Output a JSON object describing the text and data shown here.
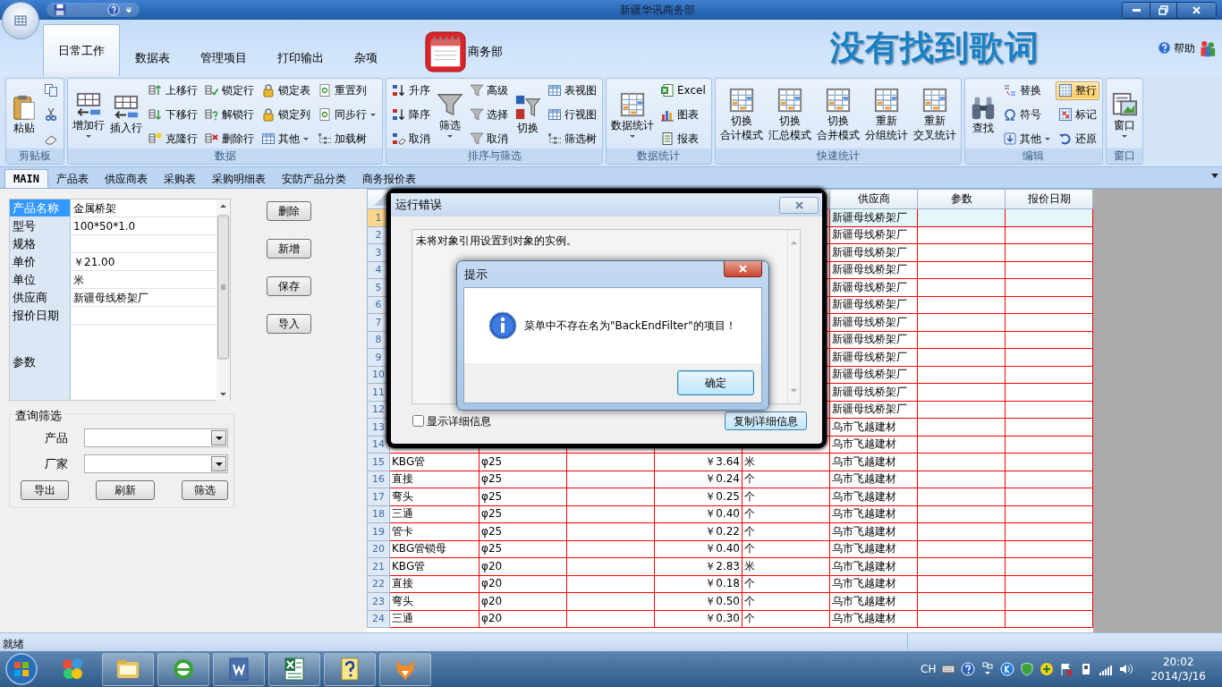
{
  "window": {
    "title": "新疆华讯商务部"
  },
  "ribbon": {
    "tabs": [
      {
        "label": "日常工作",
        "selected": true
      },
      {
        "label": "数据表",
        "selected": false
      },
      {
        "label": "管理项目",
        "selected": false
      },
      {
        "label": "打印输出",
        "selected": false
      },
      {
        "label": "杂项",
        "selected": false
      }
    ],
    "app_label": "商务部",
    "banner": "没有找到歌词",
    "help": "帮助",
    "groups": [
      {
        "label": "剪贴板",
        "columns": [
          [
            {
              "kind": "large",
              "label": "粘贴"
            }
          ],
          [
            {
              "kind": "icon"
            },
            {
              "kind": "icon"
            },
            {
              "kind": "icon"
            }
          ]
        ]
      },
      {
        "label": "数据",
        "columns": [
          [
            {
              "kind": "large-menu",
              "label": "增加行"
            }
          ],
          [
            {
              "kind": "large",
              "label": "插入行"
            }
          ],
          [
            {
              "kind": "small",
              "label": "上移行"
            },
            {
              "kind": "small",
              "label": "下移行"
            },
            {
              "kind": "small",
              "label": "克隆行"
            }
          ],
          [
            {
              "kind": "small",
              "label": "锁定行"
            },
            {
              "kind": "small",
              "label": "解锁行"
            },
            {
              "kind": "small",
              "label": "删除行"
            }
          ],
          [
            {
              "kind": "small",
              "label": "锁定表"
            },
            {
              "kind": "small",
              "label": "锁定列"
            },
            {
              "kind": "small-menu",
              "label": "其他"
            }
          ],
          [
            {
              "kind": "small",
              "label": "重置列"
            },
            {
              "kind": "small-menu",
              "label": "同步行"
            },
            {
              "kind": "small",
              "label": "加载树"
            }
          ]
        ]
      },
      {
        "label": "排序与筛选",
        "columns": [
          [
            {
              "kind": "small",
              "label": "升序"
            },
            {
              "kind": "small",
              "label": "降序"
            },
            {
              "kind": "small",
              "label": "取消"
            }
          ],
          [
            {
              "kind": "large-menu",
              "label": "筛选"
            }
          ],
          [
            {
              "kind": "small",
              "label": "高级"
            },
            {
              "kind": "small",
              "label": "选择"
            },
            {
              "kind": "small",
              "label": "取消"
            }
          ],
          [
            {
              "kind": "large",
              "label": "切换"
            }
          ],
          [
            {
              "kind": "small",
              "label": "表视图"
            },
            {
              "kind": "small",
              "label": "行视图"
            },
            {
              "kind": "small",
              "label": "筛选树"
            }
          ]
        ]
      },
      {
        "label": "数据统计",
        "columns": [
          [
            {
              "kind": "large-menu",
              "label": "数据统计"
            }
          ],
          [
            {
              "kind": "small",
              "label": "Excel"
            },
            {
              "kind": "small",
              "label": "图表"
            },
            {
              "kind": "small",
              "label": "报表"
            }
          ]
        ]
      },
      {
        "label": "快速统计",
        "columns": [
          [
            {
              "kind": "large",
              "label_lines": [
                "切换",
                "合计模式"
              ]
            }
          ],
          [
            {
              "kind": "large",
              "label_lines": [
                "切换",
                "汇总模式"
              ]
            }
          ],
          [
            {
              "kind": "large",
              "label_lines": [
                "切换",
                "合并模式"
              ]
            }
          ],
          [
            {
              "kind": "large",
              "label_lines": [
                "重新",
                "分组统计"
              ]
            }
          ],
          [
            {
              "kind": "large",
              "label_lines": [
                "重新",
                "交叉统计"
              ]
            }
          ]
        ]
      },
      {
        "label": "编辑",
        "columns": [
          [
            {
              "kind": "large",
              "label": "查找",
              "on": false
            }
          ],
          [
            {
              "kind": "small",
              "label": "替换",
              "on": false
            },
            {
              "kind": "small",
              "label": "符号",
              "on": false
            },
            {
              "kind": "small-menu",
              "label": "其他",
              "on": false
            }
          ],
          [
            {
              "kind": "small",
              "label": "整行",
              "on": true
            },
            {
              "kind": "small",
              "label": "标记",
              "on": false
            },
            {
              "kind": "small",
              "label": "还原",
              "on": false
            }
          ]
        ]
      },
      {
        "label": "窗口",
        "columns": [
          [
            {
              "kind": "large-menu",
              "label": "窗口"
            }
          ]
        ]
      }
    ]
  },
  "sheet_tabs": [
    {
      "label": "MAIN",
      "selected": true
    },
    {
      "label": "产品表",
      "selected": false
    },
    {
      "label": "供应商表",
      "selected": false
    },
    {
      "label": "采购表",
      "selected": false
    },
    {
      "label": "采购明细表",
      "selected": false
    },
    {
      "label": "安防产品分类",
      "selected": false
    },
    {
      "label": "商务报价表",
      "selected": false
    }
  ],
  "record": {
    "fields": [
      {
        "label": "产品名称",
        "value": "金属桥架",
        "selected": true
      },
      {
        "label": "型号",
        "value": "100*50*1.0",
        "selected": false
      },
      {
        "label": "规格",
        "selected": false
      },
      {
        "label": "单价",
        "value": "￥21.00",
        "selected": false
      },
      {
        "label": "单位",
        "value": "米",
        "selected": false
      },
      {
        "label": "供应商",
        "value": "新疆母线桥架厂",
        "selected": false
      },
      {
        "label": "报价日期",
        "selected": false
      },
      {
        "label": "参数",
        "selected": false
      }
    ]
  },
  "record_buttons": [
    "删除",
    "新增",
    "保存",
    "导入"
  ],
  "filter": {
    "title": "查询筛选",
    "fields": [
      {
        "label": "产品"
      },
      {
        "label": "厂家"
      }
    ],
    "buttons": [
      "导出",
      "刷新",
      "筛选"
    ]
  },
  "table": {
    "headings": {
      "supplier": "供应商",
      "parameters": "参数",
      "quote_date": "报价日期"
    },
    "rows": [
      {
        "number": "1",
        "selected": true,
        "supplier": "新疆母线桥架厂"
      },
      {
        "number": "2",
        "selected": false,
        "supplier": "新疆母线桥架厂"
      },
      {
        "number": "3",
        "selected": false,
        "supplier": "新疆母线桥架厂"
      },
      {
        "number": "4",
        "selected": false,
        "supplier": "新疆母线桥架厂"
      },
      {
        "number": "5",
        "selected": false,
        "supplier": "新疆母线桥架厂"
      },
      {
        "number": "6",
        "selected": false,
        "supplier": "新疆母线桥架厂"
      },
      {
        "number": "7",
        "selected": false,
        "supplier": "新疆母线桥架厂"
      },
      {
        "number": "8",
        "selected": false,
        "supplier": "新疆母线桥架厂"
      },
      {
        "number": "9",
        "selected": false,
        "supplier": "新疆母线桥架厂"
      },
      {
        "number": "10",
        "selected": false,
        "supplier": "新疆母线桥架厂"
      },
      {
        "number": "11",
        "selected": false,
        "supplier": "新疆母线桥架厂"
      },
      {
        "number": "12",
        "selected": false,
        "supplier": "新疆母线桥架厂"
      },
      {
        "number": "13",
        "selected": false,
        "supplier": "乌市飞越建材"
      },
      {
        "number": "14",
        "selected": false,
        "supplier": "乌市飞越建材"
      },
      {
        "number": "15",
        "selected": false,
        "column_1": "KBG管",
        "column_2": "φ25",
        "column_4": "￥3.64",
        "column_5": "米",
        "supplier": "乌市飞越建材"
      },
      {
        "number": "16",
        "selected": false,
        "column_1": "直接",
        "column_2": "φ25",
        "column_4": "￥0.24",
        "column_5": "个",
        "supplier": "乌市飞越建材"
      },
      {
        "number": "17",
        "selected": false,
        "column_1": "弯头",
        "column_2": "φ25",
        "column_4": "￥0.25",
        "column_5": "个",
        "supplier": "乌市飞越建材"
      },
      {
        "number": "18",
        "selected": false,
        "column_1": "三通",
        "column_2": "φ25",
        "column_4": "￥0.40",
        "column_5": "个",
        "supplier": "乌市飞越建材"
      },
      {
        "number": "19",
        "selected": false,
        "column_1": "管卡",
        "column_2": "φ25",
        "column_4": "￥0.22",
        "column_5": "个",
        "supplier": "乌市飞越建材"
      },
      {
        "number": "20",
        "selected": false,
        "column_1": "KBG管锁母",
        "column_2": "φ25",
        "column_4": "￥0.40",
        "column_5": "个",
        "supplier": "乌市飞越建材"
      },
      {
        "number": "21",
        "selected": false,
        "column_1": "KBG管",
        "column_2": "φ20",
        "column_4": "￥2.83",
        "column_5": "米",
        "supplier": "乌市飞越建材"
      },
      {
        "number": "22",
        "selected": false,
        "column_1": "直接",
        "column_2": "φ20",
        "column_4": "￥0.18",
        "column_5": "个",
        "supplier": "乌市飞越建材"
      },
      {
        "number": "23",
        "selected": false,
        "column_1": "弯头",
        "column_2": "φ20",
        "column_4": "￥0.50",
        "column_5": "个",
        "supplier": "乌市飞越建材"
      },
      {
        "number": "24",
        "selected": false,
        "column_1": "三通",
        "column_2": "φ20",
        "column_4": "￥0.30",
        "column_5": "个",
        "supplier": "乌市飞越建材"
      }
    ]
  },
  "error_dialog": {
    "title": "运行错误",
    "message": "未将对象引用设置到对象的实例。",
    "show_details": {
      "label": "显示详细信息",
      "checked": false
    },
    "copy_button": "复制详细信息"
  },
  "alert_dialog": {
    "title": "提示",
    "message": "菜单中不存在名为\"BackEndFilter\"的项目！",
    "ok_button": "确定"
  },
  "status_bar": {
    "text": "就绪"
  },
  "taskbar": {
    "language": "CH",
    "time": "20:02",
    "date": "2014/3/16"
  }
}
